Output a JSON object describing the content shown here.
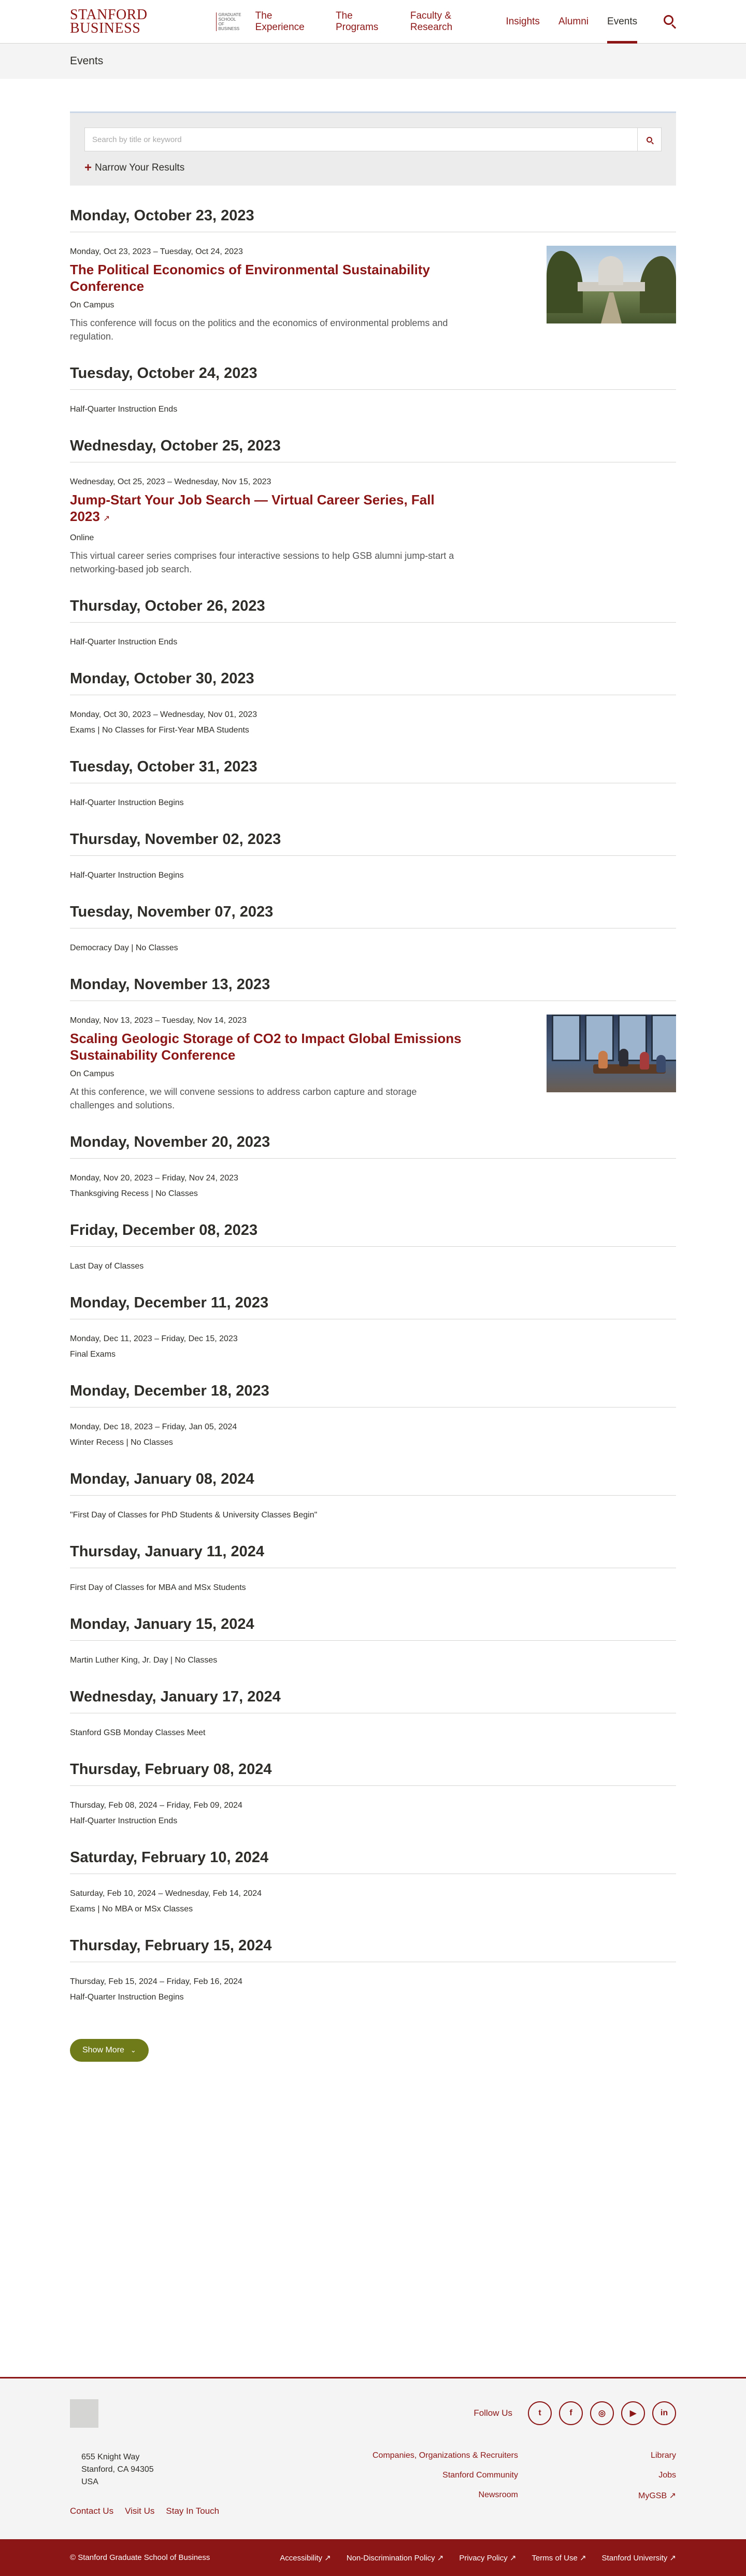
{
  "header": {
    "logo_main": "STANFORD BUSINESS",
    "logo_sub": "Graduate School of Business",
    "nav": [
      "The Experience",
      "The Programs",
      "Faculty & Research",
      "Insights",
      "Alumni",
      "Events"
    ],
    "active": "Events"
  },
  "page_title": "Events",
  "filter": {
    "placeholder": "Search by title or keyword",
    "narrow_label": "Narrow Your Results"
  },
  "days": [
    {
      "heading": "Monday, October 23, 2023",
      "events": [
        {
          "date": "Monday, Oct 23, 2023 – Tuesday, Oct 24, 2023",
          "title": "The Political Economics of Environmental Sustainability Conference",
          "location": "On Campus",
          "description": "This conference will focus on the politics and the economics of environmental problems and regulation.",
          "image": "capitol"
        }
      ]
    },
    {
      "heading": "Tuesday, October 24, 2023",
      "notes": [
        "Half-Quarter Instruction Ends"
      ]
    },
    {
      "heading": "Wednesday, October 25, 2023",
      "events": [
        {
          "date": "Wednesday, Oct 25, 2023 – Wednesday, Nov 15, 2023",
          "title": "Jump-Start Your Job Search — Virtual Career Series, Fall 2023",
          "external": true,
          "location": "Online",
          "description": "This virtual career series comprises four interactive sessions to help GSB alumni jump-start a networking-based job search."
        }
      ]
    },
    {
      "heading": "Thursday, October 26, 2023",
      "notes": [
        "Half-Quarter Instruction Ends"
      ]
    },
    {
      "heading": "Monday, October 30, 2023",
      "notes": [
        "Monday, Oct 30, 2023 – Wednesday, Nov 01, 2023",
        "Exams | No Classes for First-Year MBA Students"
      ]
    },
    {
      "heading": "Tuesday, October 31, 2023",
      "notes": [
        "Half-Quarter Instruction Begins"
      ]
    },
    {
      "heading": "Thursday, November 02, 2023",
      "notes": [
        "Half-Quarter Instruction Begins"
      ]
    },
    {
      "heading": "Tuesday, November 07, 2023",
      "notes": [
        "Democracy Day | No Classes"
      ]
    },
    {
      "heading": "Monday, November 13, 2023",
      "events": [
        {
          "date": "Monday, Nov 13, 2023 – Tuesday, Nov 14, 2023",
          "title": "Scaling Geologic Storage of CO2 to Impact Global Emissions Sustainability Conference",
          "location": "On Campus",
          "description": "At this conference, we will convene sessions to address carbon capture and storage challenges and solutions.",
          "image": "meeting"
        }
      ]
    },
    {
      "heading": "Monday, November 20, 2023",
      "notes": [
        "Monday, Nov 20, 2023 – Friday, Nov 24, 2023",
        "Thanksgiving Recess | No Classes"
      ]
    },
    {
      "heading": "Friday, December 08, 2023",
      "notes": [
        "Last Day of Classes"
      ]
    },
    {
      "heading": "Monday, December 11, 2023",
      "notes": [
        "Monday, Dec 11, 2023 – Friday, Dec 15, 2023",
        "Final Exams"
      ]
    },
    {
      "heading": "Monday, December 18, 2023",
      "notes": [
        "Monday, Dec 18, 2023 – Friday, Jan 05, 2024",
        "Winter Recess | No Classes"
      ]
    },
    {
      "heading": "Monday, January 08, 2024",
      "notes": [
        "\"First Day of Classes for PhD Students & University Classes Begin\""
      ]
    },
    {
      "heading": "Thursday, January 11, 2024",
      "notes": [
        "First Day of Classes for MBA and MSx Students"
      ]
    },
    {
      "heading": "Monday, January 15, 2024",
      "notes": [
        "Martin Luther King, Jr. Day | No Classes"
      ]
    },
    {
      "heading": "Wednesday, January 17, 2024",
      "notes": [
        "Stanford GSB Monday Classes Meet"
      ]
    },
    {
      "heading": "Thursday, February 08, 2024",
      "notes": [
        "Thursday, Feb 08, 2024 – Friday, Feb 09, 2024",
        "Half-Quarter Instruction Ends"
      ]
    },
    {
      "heading": "Saturday, February 10, 2024",
      "notes": [
        "Saturday, Feb 10, 2024 – Wednesday, Feb 14, 2024",
        "Exams | No MBA or MSx Classes"
      ]
    },
    {
      "heading": "Thursday, February 15, 2024",
      "notes": [
        "Thursday, Feb 15, 2024 – Friday, Feb 16, 2024",
        "Half-Quarter Instruction Begins"
      ]
    }
  ],
  "show_more": "Show More",
  "footer": {
    "follow_label": "Follow Us",
    "social": [
      {
        "icon": "twitter-icon",
        "glyph": "t"
      },
      {
        "icon": "facebook-icon",
        "glyph": "f"
      },
      {
        "icon": "instagram-icon",
        "glyph": "◎"
      },
      {
        "icon": "youtube-icon",
        "glyph": "▶"
      },
      {
        "icon": "linkedin-icon",
        "glyph": "in"
      }
    ],
    "address": [
      "655 Knight Way",
      "Stanford, CA 94305",
      "USA"
    ],
    "links_row": [
      "Contact Us",
      "Visit Us",
      "Stay In Touch"
    ],
    "col_mid": [
      "Companies, Organizations & Recruiters",
      "Stanford Community",
      "Newsroom"
    ],
    "col_right": [
      "Library",
      "Jobs",
      "MyGSB ↗"
    ]
  },
  "bottom": {
    "copyright": "© Stanford Graduate School of Business",
    "links": [
      "Accessibility ↗",
      "Non-Discrimination Policy ↗",
      "Privacy Policy ↗",
      "Terms of Use ↗",
      "Stanford University ↗"
    ]
  },
  "colors": {
    "brand": "#8c1515",
    "show_more": "#6f7a18"
  }
}
